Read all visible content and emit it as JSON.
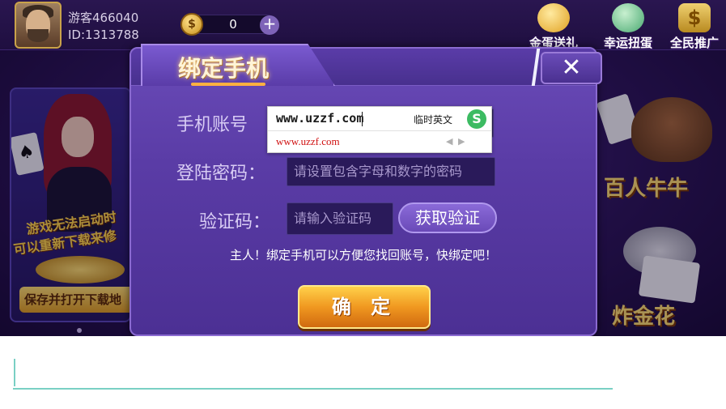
{
  "topbar": {
    "username": "游客466040",
    "user_id": "ID:1313788",
    "coins": "0",
    "coin_symbol": "$",
    "add_symbol": "+",
    "icons": [
      {
        "label": "金蛋送礼",
        "icon": "gold-egg-icon"
      },
      {
        "label": "幸运扭蛋",
        "icon": "lucky-egg-icon"
      },
      {
        "label": "全民推广",
        "icon": "dollar-bag-icon"
      }
    ]
  },
  "left_banner": {
    "line1": "游戏无法启动时",
    "line2": "可以重新下载来修",
    "button": "保存并打开下载地",
    "card_symbol": "♠"
  },
  "right_games": [
    {
      "label": "百人牛牛"
    },
    {
      "label": "炸金花"
    }
  ],
  "dialog": {
    "title": "绑定手机",
    "close_symbol": "✕",
    "phone_label": "手机账号",
    "phone_value": "",
    "password_label": "登陆密码：",
    "password_placeholder": "请设置包含字母和数字的密码",
    "code_label": "验证码：",
    "code_placeholder": "请输入验证码",
    "get_code_button": "获取验证",
    "hint": "主人！绑定手机可以方便您找回账号，快绑定吧！",
    "confirm_button": "确 定"
  },
  "ime": {
    "composing": "www.uzzf.com",
    "mode": "临时英文",
    "logo": "S",
    "candidate": "www.uzzf.com",
    "prev": "◀",
    "next": "▶"
  },
  "colors": {
    "dialog_bg": "#5a3ca6",
    "confirm_orange": "#f09820",
    "accent_teal": "#7ad0c4",
    "title_gold": "#fff4d8"
  }
}
